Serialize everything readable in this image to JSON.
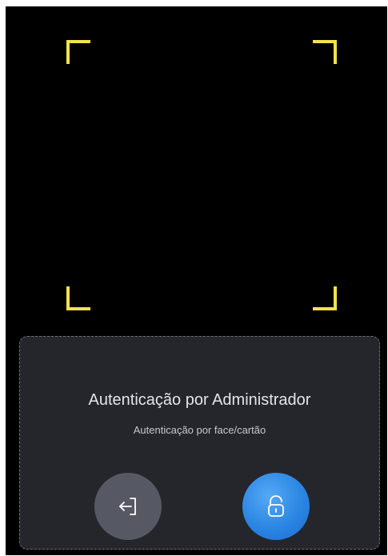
{
  "panel": {
    "title": "Autenticação por Administrador",
    "subtitle": "Autenticação por face/cartão"
  },
  "buttons": {
    "exit": {
      "icon": "exit-icon"
    },
    "unlock": {
      "icon": "unlock-icon"
    }
  },
  "colors": {
    "frame_corner": "#f3e24a",
    "background": "#000000",
    "panel": "#25262b",
    "exit_button": "#565863",
    "unlock_button": "#2a86e3"
  }
}
